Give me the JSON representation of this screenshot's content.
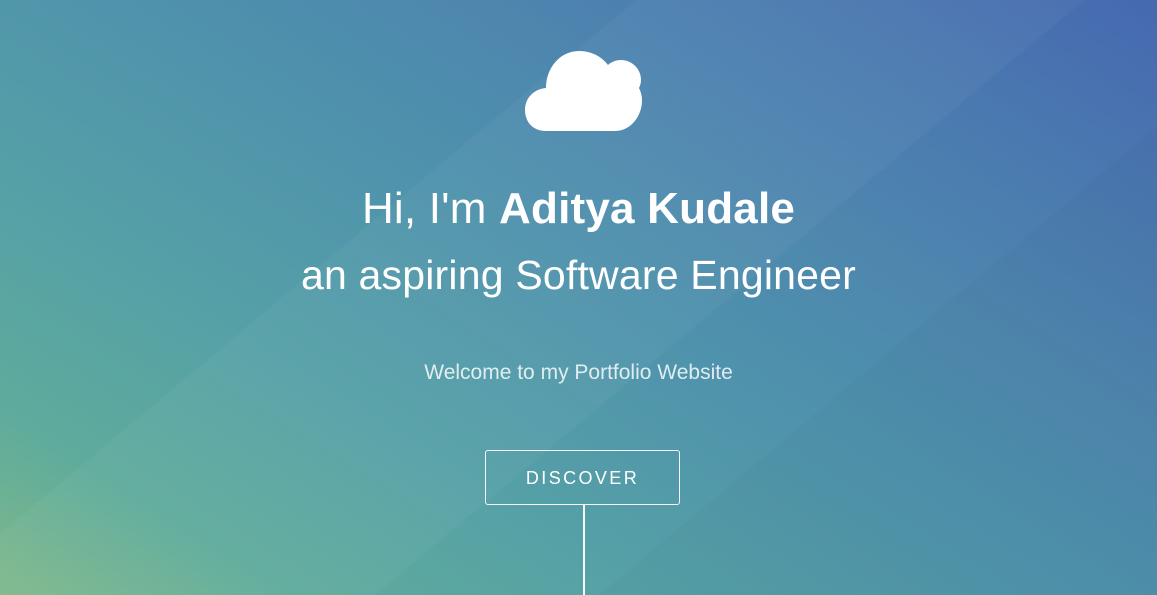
{
  "hero": {
    "icon": "cloud-icon",
    "greeting": "Hi, I'm ",
    "name": "Aditya Kudale",
    "subtitle": "an aspiring Software Engineer",
    "welcome": "Welcome to my Portfolio Website",
    "discover_label": "DISCOVER"
  },
  "colors": {
    "gradient_start": "#7fb98a",
    "gradient_mid": "#4f92ac",
    "gradient_end": "#4669b0",
    "text": "#ffffff"
  }
}
